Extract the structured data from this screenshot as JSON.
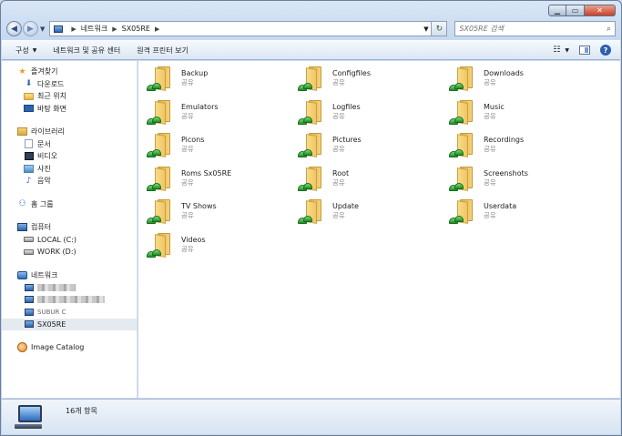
{
  "window": {
    "min_glyph": "▁",
    "max_glyph": "▭",
    "close_glyph": "✕"
  },
  "address": {
    "crumbs": [
      "네트워크",
      "SX05RE"
    ],
    "search_placeholder": "SX05RE 검색"
  },
  "toolbar": {
    "organize": "구성",
    "network_center": "네트워크 및 공유 센터",
    "remote_printer": "원격 프린터 보기"
  },
  "nav": {
    "favorites": {
      "label": "즐겨찾기",
      "items": [
        "다운로드",
        "최근 위치",
        "바탕 화면"
      ]
    },
    "libraries": {
      "label": "라이브러리",
      "items": [
        "문서",
        "비디오",
        "사진",
        "음악"
      ]
    },
    "homegroup": "홈 그룹",
    "computer": {
      "label": "컴퓨터",
      "items": [
        "LOCAL (C:)",
        "WORK (D:)"
      ]
    },
    "network": {
      "label": "네트워크",
      "visible_partial": "SUBUR C",
      "selected": "SX05RE"
    },
    "image_catalog": "Image Catalog"
  },
  "items": [
    {
      "name": "Backup",
      "sub": "공유"
    },
    {
      "name": "Configfiles",
      "sub": "공유"
    },
    {
      "name": "Downloads",
      "sub": "공유"
    },
    {
      "name": "Emulators",
      "sub": "공유"
    },
    {
      "name": "Logfiles",
      "sub": "공유"
    },
    {
      "name": "Music",
      "sub": "공유"
    },
    {
      "name": "Picons",
      "sub": "공유"
    },
    {
      "name": "Pictures",
      "sub": "공유"
    },
    {
      "name": "Recordings",
      "sub": "공유"
    },
    {
      "name": "Roms Sx05RE",
      "sub": "공유"
    },
    {
      "name": "Root",
      "sub": "공유"
    },
    {
      "name": "Screenshots",
      "sub": "공유"
    },
    {
      "name": "TV Shows",
      "sub": "공유"
    },
    {
      "name": "Update",
      "sub": "공유"
    },
    {
      "name": "Userdata",
      "sub": "공유"
    },
    {
      "name": "Videos",
      "sub": "공유"
    }
  ],
  "status": {
    "count_text": "16개 항목"
  }
}
